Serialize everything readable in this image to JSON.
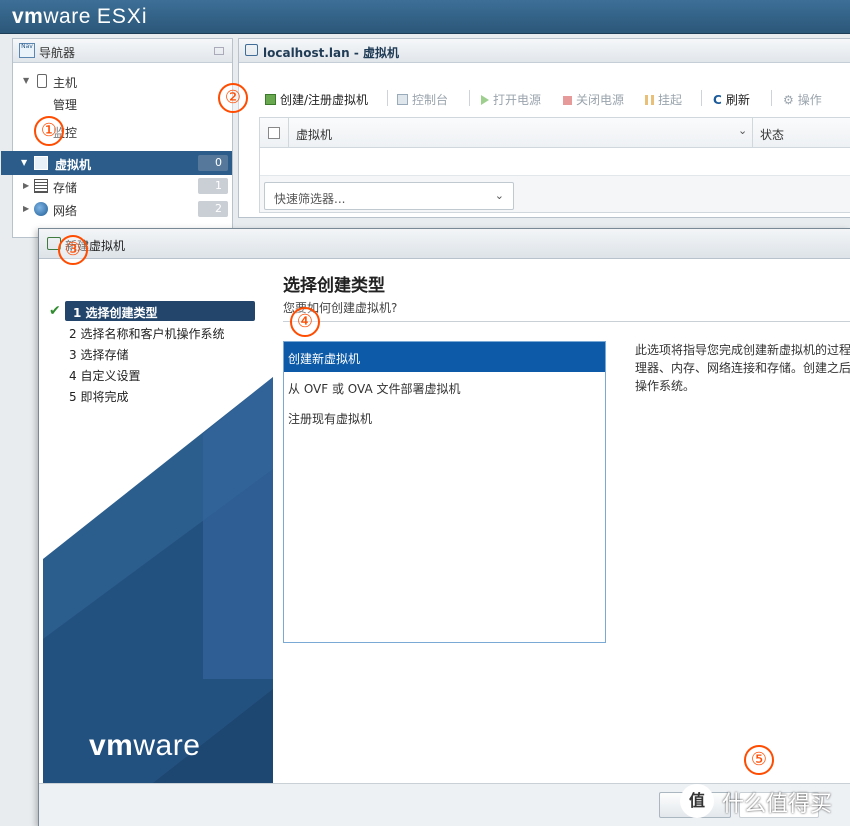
{
  "header": {
    "brand": "vm",
    "brand_tail": "ware",
    "product": "ESXi"
  },
  "navigator": {
    "title": "导航器",
    "icon_text": "Nav",
    "items": [
      {
        "label": "主机",
        "count": ""
      },
      {
        "label": "管理",
        "count": ""
      },
      {
        "label": "监控",
        "count": ""
      },
      {
        "label": "虚拟机",
        "count": "0"
      },
      {
        "label": "存储",
        "count": "1"
      },
      {
        "label": "网络",
        "count": "2"
      }
    ]
  },
  "vm_panel": {
    "title": "localhost.lan - 虚拟机",
    "toolbar": {
      "create": "创建/注册虚拟机",
      "console": "控制台",
      "power_on": "打开电源",
      "power_off": "关闭电源",
      "suspend": "挂起",
      "refresh": "刷新",
      "actions": "操作"
    },
    "table": {
      "col_name": "虚拟机",
      "col_status": "状态",
      "filter_placeholder": "快速筛选器..."
    }
  },
  "wizard": {
    "title": "新建虚拟机",
    "steps": [
      "1 选择创建类型",
      "2 选择名称和客户机操作系统",
      "3 选择存储",
      "4 自定义设置",
      "5 即将完成"
    ],
    "logo_bold": "vm",
    "logo_tail": "ware",
    "heading": "选择创建类型",
    "subheading": "您要如何创建虚拟机?",
    "types": [
      "创建新虚拟机",
      "从 OVF 或 OVA 文件部署虚拟机",
      "注册现有虚拟机"
    ],
    "description": [
      "此选项将指导您完成创建新虚拟机的过程",
      "理器、内存、网络连接和存储。创建之后",
      "操作系统。"
    ]
  },
  "annotations": [
    "①",
    "②",
    "③",
    "④",
    "⑤"
  ],
  "watermark": {
    "badge": "值",
    "text": "什么值得买"
  }
}
